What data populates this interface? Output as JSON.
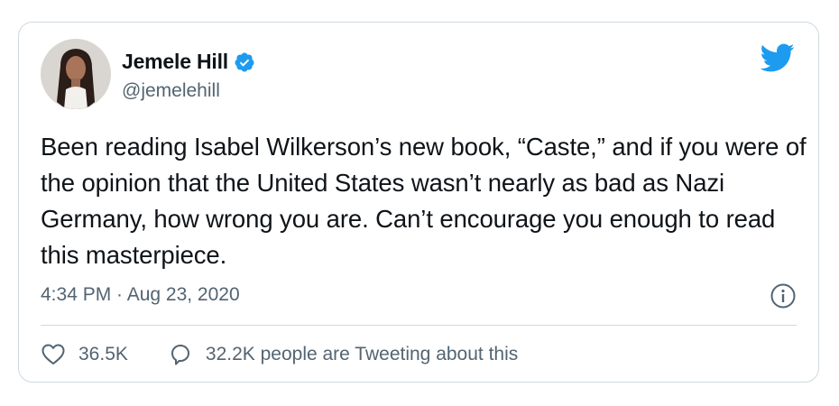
{
  "author": {
    "display_name": "Jemele Hill",
    "handle": "@jemelehill",
    "verified": true
  },
  "tweet": {
    "text": "Been reading Isabel Wilkerson’s new book, “Caste,” and if you were of the opinion that the United States wasn’t nearly as bad as Nazi Germany, how wrong you are. Can’t encourage you enough to read this masterpiece.",
    "timestamp": "4:34 PM · Aug 23, 2020"
  },
  "actions": {
    "likes": "36.5K",
    "tweeting": "32.2K people are Tweeting about this"
  },
  "icons": {
    "brand": "twitter-bird-icon",
    "verified": "verified-badge-icon",
    "info": "info-icon",
    "like": "heart-icon",
    "reply": "speech-bubble-icon"
  },
  "colors": {
    "brand_blue": "#1d9bf0",
    "text_primary": "#0f1419",
    "text_secondary": "#536471",
    "border": "#cfd9de"
  }
}
